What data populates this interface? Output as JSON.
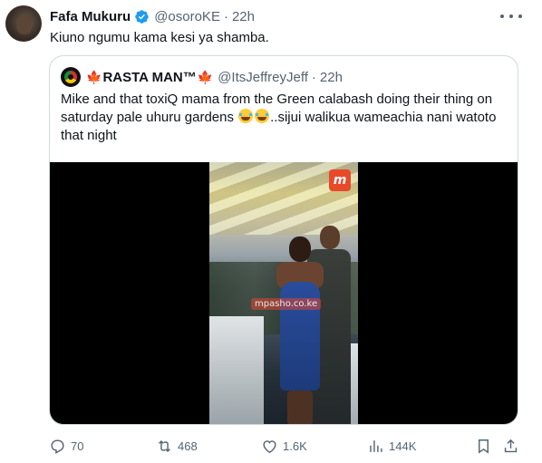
{
  "tweet": {
    "author_name": "Fafa Mukuru",
    "handle": "@osoroKE",
    "separator": "·",
    "time": "22h",
    "text": "Kiuno ngumu kama kesi ya shamba."
  },
  "quote": {
    "author_name": "RASTA MAN™",
    "leaf_left": "🍁",
    "leaf_right": "🍁",
    "handle": "@ItsJeffreyJeff",
    "separator": "·",
    "time": "22h",
    "text_part1": "Mike and that toxiQ mama from the Green calabash doing their thing on saturday pale uhuru gardens",
    "text_part2": "..sijui walikua wameachia nani watoto that night",
    "emoji_name": "face-with-tears-of-joy",
    "video": {
      "badge_text": "m",
      "watermark": "mpasho.co.ke"
    }
  },
  "actions": {
    "replies": "70",
    "retweets": "468",
    "likes": "1.6K",
    "views": "144K"
  },
  "colors": {
    "text": "#0f1419",
    "secondary": "#536471",
    "verified": "#1d9bf0",
    "border": "#cfd9de"
  }
}
